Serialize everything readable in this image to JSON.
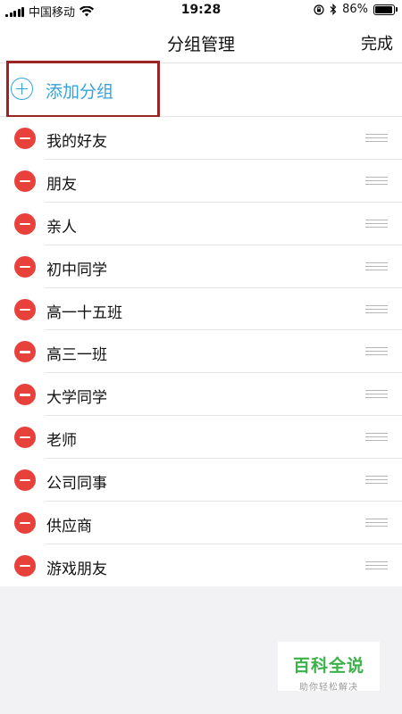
{
  "status_bar": {
    "carrier": "中国移动",
    "time": "19:28",
    "battery": "86%",
    "battery_level": 0.86,
    "icons": [
      "signal-icon",
      "wifi-icon",
      "orientation-lock-icon",
      "bluetooth-icon",
      "battery-icon"
    ]
  },
  "nav": {
    "title": "分组管理",
    "done_label": "完成"
  },
  "add_group": {
    "label": "添加分组",
    "icon": "add-circle-icon",
    "color": "#35a3dd",
    "highlight_color": "#9b2424"
  },
  "groups": [
    {
      "label": "我的好友"
    },
    {
      "label": "朋友"
    },
    {
      "label": "亲人"
    },
    {
      "label": "初中同学"
    },
    {
      "label": "高一十五班"
    },
    {
      "label": "高三一班"
    },
    {
      "label": "大学同学"
    },
    {
      "label": "老师"
    },
    {
      "label": "公司同事"
    },
    {
      "label": "供应商"
    },
    {
      "label": "游戏朋友"
    }
  ],
  "row_icons": {
    "delete": "delete-minus-icon",
    "reorder": "reorder-handle-icon",
    "delete_color": "#e8413b"
  },
  "watermark": {
    "title": "百科全说",
    "subtitle": "助你轻松解决",
    "color": "#3bb249"
  }
}
